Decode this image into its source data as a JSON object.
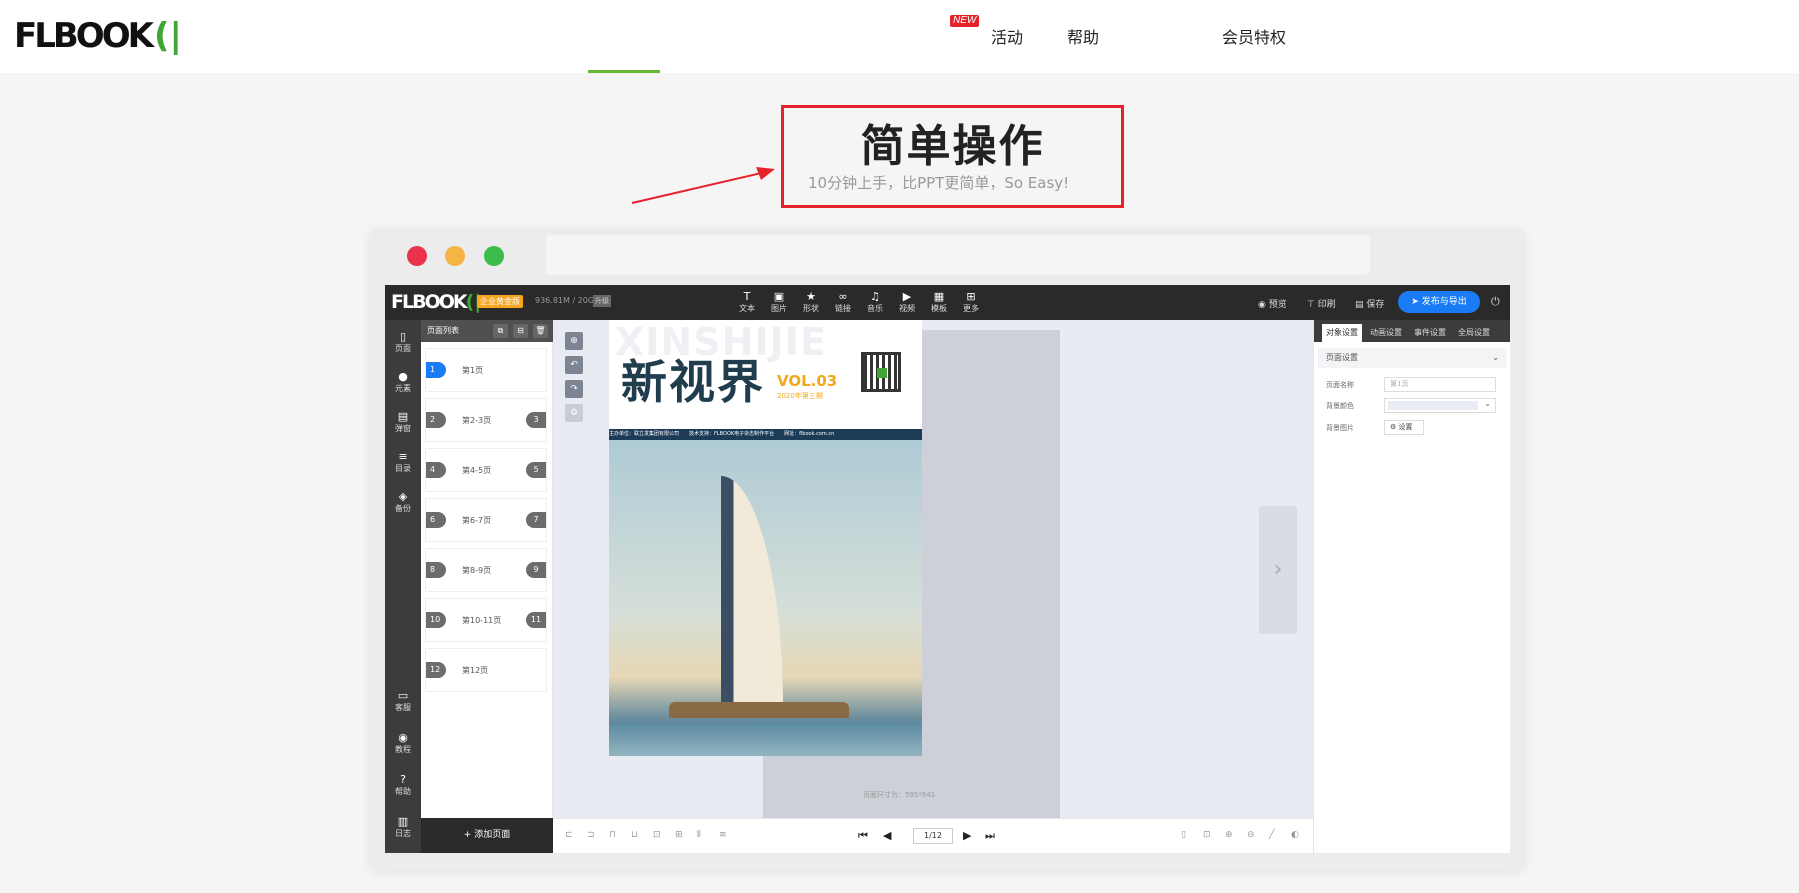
{
  "site": {
    "logo_text": "FLBOOK",
    "nav": {
      "new_badge": "NEW",
      "activity": "活动",
      "help": "帮助",
      "vip": "会员特权"
    }
  },
  "hero": {
    "title": "简单操作",
    "subtitle": "10分钟上手，比PPT更简单，So Easy!"
  },
  "colors": {
    "accent_green": "#68b834",
    "highlight_red": "#e8222d",
    "publish_blue": "#1a7cf5"
  },
  "editor": {
    "logo": "FLBOOK",
    "badge": "企业黄金版",
    "storage": "936.81M / 20G",
    "upgrade": "升级",
    "toolbar": [
      {
        "icon": "text-icon",
        "label": "文本"
      },
      {
        "icon": "image-icon",
        "label": "图片"
      },
      {
        "icon": "shape-icon",
        "label": "形状"
      },
      {
        "icon": "link-icon",
        "label": "链接"
      },
      {
        "icon": "music-icon",
        "label": "音乐"
      },
      {
        "icon": "video-icon",
        "label": "视频"
      },
      {
        "icon": "template-icon",
        "label": "模板"
      },
      {
        "icon": "more-icon",
        "label": "更多"
      }
    ],
    "top_right": {
      "preview": "预览",
      "print": "印刷",
      "save": "保存",
      "publish": "发布与导出"
    },
    "left_nav_top": [
      {
        "icon": "page-icon",
        "label": "页面"
      },
      {
        "icon": "element-icon",
        "label": "元素"
      },
      {
        "icon": "popup-icon",
        "label": "弹窗"
      },
      {
        "icon": "toc-icon",
        "label": "目录"
      },
      {
        "icon": "backup-icon",
        "label": "备份"
      }
    ],
    "left_nav_bottom": [
      {
        "icon": "service-icon",
        "label": "客服"
      },
      {
        "icon": "tutorial-icon",
        "label": "教程"
      },
      {
        "icon": "help-icon",
        "label": "帮助"
      },
      {
        "icon": "log-icon",
        "label": "日志"
      }
    ],
    "page_list": {
      "title": "页面列表",
      "pages": [
        {
          "left": "1",
          "name": "第1页",
          "right": ""
        },
        {
          "left": "2",
          "name": "第2-3页",
          "right": "3"
        },
        {
          "left": "4",
          "name": "第4-5页",
          "right": "5"
        },
        {
          "left": "6",
          "name": "第6-7页",
          "right": "7"
        },
        {
          "left": "8",
          "name": "第8-9页",
          "right": "9"
        },
        {
          "left": "10",
          "name": "第10-11页",
          "right": "11"
        },
        {
          "left": "12",
          "name": "第12页",
          "right": ""
        }
      ],
      "add_page": "+ 添加页面"
    },
    "cover": {
      "bg_text": "XINSHIJIE",
      "title": "新视界",
      "vol": "VOL.03",
      "issue": "2020年第三期",
      "strip": "主办单位：联立发集团有限公司　　技术支持：FLBOOK电子杂志制作平台　　网址：flbook.com.cn"
    },
    "page_size": "页面尺寸为：595*841",
    "pager": "1/12",
    "props": {
      "tabs": [
        "对象设置",
        "动画设置",
        "事件设置",
        "全局设置"
      ],
      "section": "页面设置",
      "page_name_label": "页面名称",
      "page_name_value": "第1页",
      "bg_color_label": "背景颜色",
      "bg_image_label": "背景图片",
      "bg_image_button": "设置"
    }
  }
}
